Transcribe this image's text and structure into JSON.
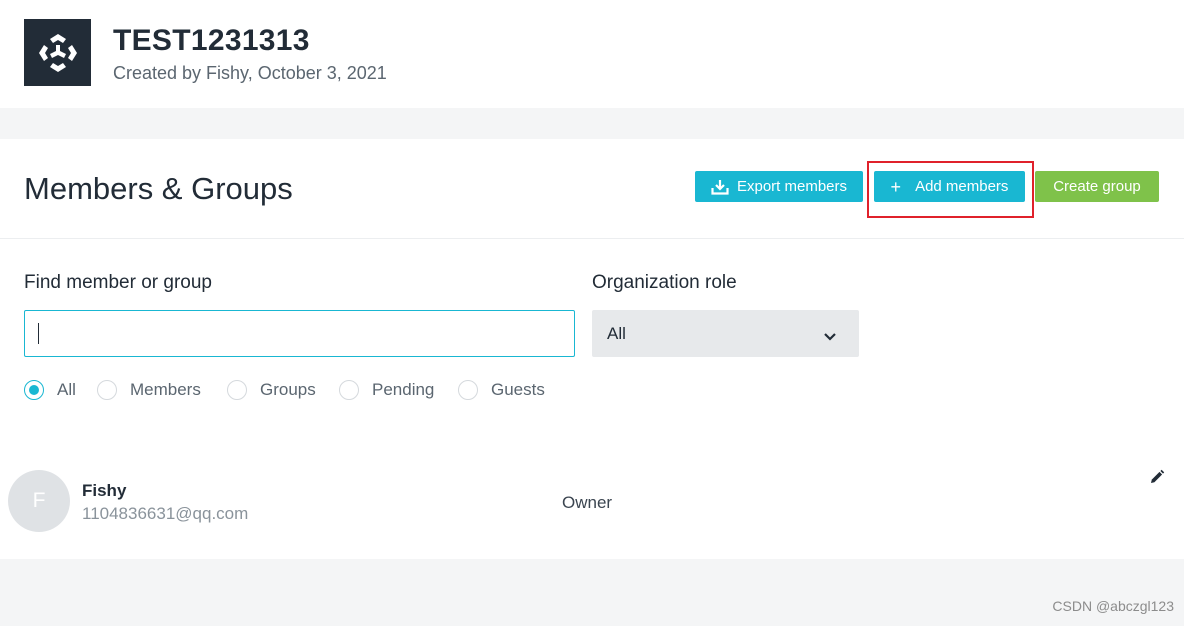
{
  "org": {
    "name": "TEST1231313",
    "created": "Created by Fishy, October 3, 2021",
    "logo_icon": "unity-logo-icon"
  },
  "section": {
    "title": "Members & Groups",
    "export_label": "Export members",
    "export_icon": "download-icon",
    "add_label": "Add members",
    "add_icon": "plus-icon",
    "create_label": "Create group"
  },
  "filters": {
    "find_label": "Find member or group",
    "search_value": "",
    "role_label": "Organization role",
    "role_value": "All",
    "radios": [
      {
        "label": "All",
        "checked": true
      },
      {
        "label": "Members",
        "checked": false
      },
      {
        "label": "Groups",
        "checked": false
      },
      {
        "label": "Pending",
        "checked": false
      },
      {
        "label": "Guests",
        "checked": false
      }
    ]
  },
  "members": [
    {
      "initial": "F",
      "name": "Fishy",
      "email": "1104836631@qq.com",
      "role": "Owner"
    }
  ],
  "watermark": "CSDN @abczgl123",
  "colors": {
    "primary": "#19b7d2",
    "create": "#7fc24a",
    "highlight": "#e0212b",
    "logo_bg": "#222c37"
  }
}
